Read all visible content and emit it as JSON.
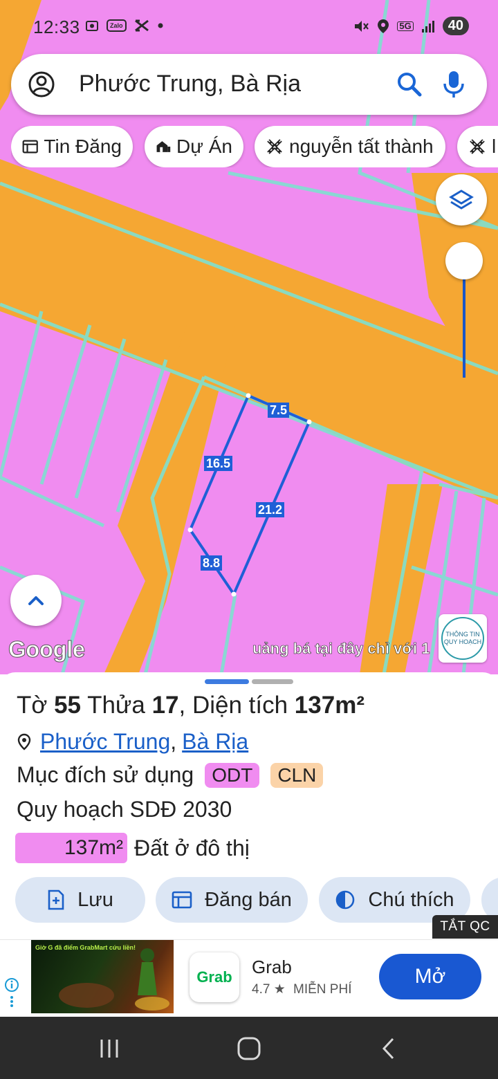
{
  "status_bar": {
    "time": "12:33",
    "zalo": "Zalo",
    "network": "5G",
    "battery": "40"
  },
  "search": {
    "query": "Phước Trung, Bà Rịa"
  },
  "chips": [
    {
      "label": "Tin Đăng",
      "icon": "listing-icon"
    },
    {
      "label": "Dự Án",
      "icon": "project-icon"
    },
    {
      "label": "nguyễn tất thành",
      "icon": "road-icon"
    },
    {
      "label": "l",
      "icon": "road-icon"
    }
  ],
  "map": {
    "dimensions": [
      "7.5",
      "16.5",
      "21.2",
      "8.8"
    ],
    "colors": {
      "residential": "#f08cf0",
      "road": "#f5a733",
      "boundary": "#7fe0d0",
      "parcel": "#1f5fd6"
    },
    "google_logo": "Google",
    "marquee": "uảng bá tại đây chỉ với 1",
    "info_badge_line1": "THÔNG TIN",
    "info_badge_line2": "QUY HOẠCH"
  },
  "sheet": {
    "title_prefix": "Tờ ",
    "sheet_no": "55",
    "title_mid": " Thửa ",
    "parcel_no": "17",
    "title_area_prefix": ", Diện tích ",
    "area": "137m²",
    "ward": "Phước Trung",
    "separator": ",",
    "city": "Bà Rịa",
    "purpose_label": "Mục đích sử dụng",
    "purpose_tags": [
      {
        "code": "ODT",
        "color": "#f08cf0"
      },
      {
        "code": "CLN",
        "color": "#fbd3a8"
      }
    ],
    "plan_label": "Quy hoạch SDĐ 2030",
    "area_value": "137m²",
    "area_type": "Đất ở đô thị",
    "actions": [
      {
        "label": "Lưu",
        "icon": "save-icon"
      },
      {
        "label": "Đăng bán",
        "icon": "listing-icon"
      },
      {
        "label": "Chú thích",
        "icon": "legend-icon"
      }
    ]
  },
  "ad": {
    "close_label": "TẮT QC",
    "image_text": "Giờ G đã điểm GrabMart cứu liền!",
    "app_icon_text": "Grab",
    "app_name": "Grab",
    "rating": "4.7",
    "price": "MIỄN PHÍ",
    "open_label": "Mở"
  }
}
